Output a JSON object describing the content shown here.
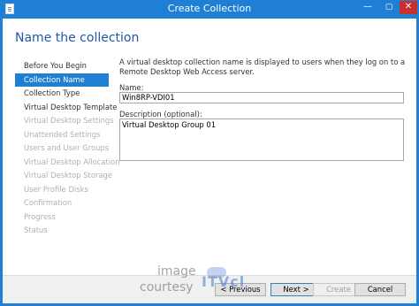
{
  "window": {
    "title": "Create Collection",
    "controls": {
      "minimize": "—",
      "maximize": "▢",
      "close": "✕"
    }
  },
  "header": {
    "title": "Name the collection"
  },
  "nav": {
    "items": [
      {
        "label": "Before You Begin",
        "state": "normal"
      },
      {
        "label": "Collection Name",
        "state": "selected"
      },
      {
        "label": "Collection Type",
        "state": "normal"
      },
      {
        "label": "Virtual Desktop Template",
        "state": "normal"
      },
      {
        "label": "Virtual Desktop Settings",
        "state": "disabled"
      },
      {
        "label": "Unattended Settings",
        "state": "disabled"
      },
      {
        "label": "Users and User Groups",
        "state": "disabled"
      },
      {
        "label": "Virtual Desktop Allocation",
        "state": "disabled"
      },
      {
        "label": "Virtual Desktop Storage",
        "state": "disabled"
      },
      {
        "label": "User Profile Disks",
        "state": "disabled"
      },
      {
        "label": "Confirmation",
        "state": "disabled"
      },
      {
        "label": "Progress",
        "state": "disabled"
      },
      {
        "label": "Status",
        "state": "disabled"
      }
    ]
  },
  "main": {
    "description": "A virtual desktop collection name is displayed to users when they log on to a Remote Desktop Web Access server.",
    "name_label": "Name:",
    "name_value": "Win8RP-VDI01",
    "description_label": "Description (optional):",
    "description_value": "Virtual Desktop Group 01"
  },
  "footer": {
    "previous": "< Previous",
    "next": "Next >",
    "create": "Create",
    "cancel": "Cancel"
  },
  "watermark": {
    "line1": "image",
    "line2": "courtesy",
    "logo": "ITVcl"
  }
}
